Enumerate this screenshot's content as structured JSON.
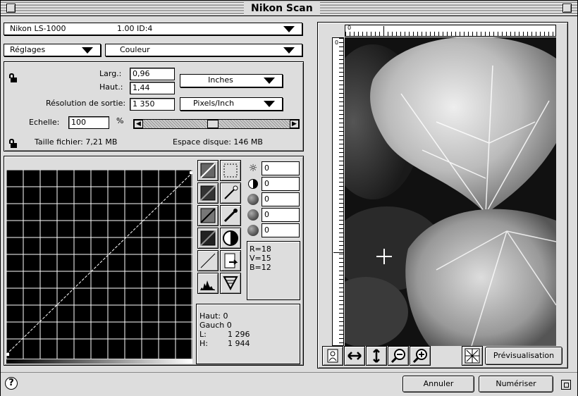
{
  "window": {
    "title": "Nikon Scan"
  },
  "scanner": {
    "device": "Nikon  LS-1000",
    "version": "1.00  ID:4"
  },
  "settings": {
    "reglages_label": "Réglages",
    "color_mode": "Couleur"
  },
  "dimensions": {
    "width_label": "Larg.:",
    "width_value": "0,96",
    "height_label": "Haut.:",
    "height_value": "1,44",
    "unit": "Inches",
    "resolution_label": "Résolution de sortie:",
    "resolution_value": "1 350",
    "resolution_unit": "Pixels/Inch",
    "scale_label": "Echelle:",
    "scale_value": "100",
    "scale_unit": "%",
    "filesize_label": "Taille fichier: 7,21 MB",
    "diskspace_label": "Espace disque: 146 MB"
  },
  "adjustments": [
    {
      "icon": "brightness-icon",
      "value": "0"
    },
    {
      "icon": "contrast-icon",
      "value": "0"
    },
    {
      "icon": "red-balance-icon",
      "value": "0"
    },
    {
      "icon": "green-balance-icon",
      "value": "0"
    },
    {
      "icon": "blue-balance-icon",
      "value": "0"
    }
  ],
  "rgb": {
    "r": "R=18",
    "v": "V=15",
    "b": "B=12"
  },
  "crop_info": {
    "haut": "Haut: 0",
    "gauch": "Gauch 0",
    "l_label": "L:",
    "l_value": "1 296",
    "h_label": "H:",
    "h_value": "1 944"
  },
  "ruler": {
    "zero_h": "0",
    "zero_v": "0"
  },
  "buttons": {
    "preview": "Prévisualisation",
    "cancel": "Annuler",
    "scan": "Numériser"
  },
  "help": {
    "glyph": "?"
  }
}
